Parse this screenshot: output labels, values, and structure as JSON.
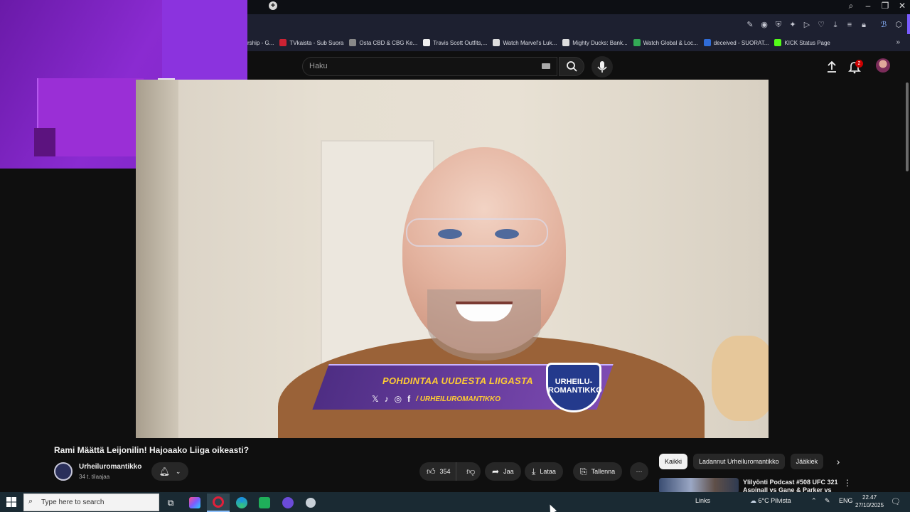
{
  "colors": {
    "accent": "#7a5cff",
    "bg": "#0f0f0f",
    "chip_active": "#f1f1f1",
    "badge": "#cc0000"
  },
  "bookmarks": [
    {
      "label": "rship - G...",
      "icon": "bookmark-icon",
      "color": "#888888"
    },
    {
      "label": "TVkaista - Sub Suora",
      "icon": "tvkaista-icon",
      "color": "#cc2233"
    },
    {
      "label": "Osta CBD & CBG Ke...",
      "icon": "globe-icon",
      "color": "#888888"
    },
    {
      "label": "Travis Scott Outfits,...",
      "icon": "tiktok-icon",
      "color": "#eeeeee"
    },
    {
      "label": "Watch Marvel's Luk...",
      "icon": "swirl-icon",
      "color": "#dddddd"
    },
    {
      "label": "Mighty Ducks: Bank...",
      "icon": "star-icon",
      "color": "#dddddd"
    },
    {
      "label": "Watch Global & Loc...",
      "icon": "alien-icon",
      "color": "#33aa55"
    },
    {
      "label": "deceived - SUORAT...",
      "icon": "flag-icon",
      "color": "#2f6cd8"
    },
    {
      "label": "KICK Status Page",
      "icon": "kick-icon",
      "color": "#53fc18"
    }
  ],
  "search": {
    "placeholder": "Haku"
  },
  "notifications": {
    "count": "2"
  },
  "video": {
    "overlay_title": "POHDINTAA UUDESTA LIIGASTA",
    "overlay_handle": "/ URHEILUROMANTIKKO",
    "badge_text": "URHEILU-\nROMANTIKKO"
  },
  "watch": {
    "title": "Rami Määttä Leijonilin! Hajoaako Liiga oikeasti?",
    "channel": "Urheiluromantikko",
    "subscribers": "34 t. tilaajaa",
    "likes": "354",
    "share": "Jaa",
    "download": "Lataa",
    "save": "Tallenna",
    "more": "⋯"
  },
  "chips": [
    "Kaikki",
    "Ladannut Urheiluromantikko",
    "Jääkiek"
  ],
  "recommendation": {
    "title": "Ylilyönti Podcast #508 UFC 321 Aspinall vs Gane & Parker vs"
  },
  "taskbar": {
    "search_placeholder": "Type here to search",
    "links": "Links",
    "weather": "6°C Pilvista",
    "lang": "ENG",
    "time": "22.47",
    "date": "27/10/2025"
  }
}
